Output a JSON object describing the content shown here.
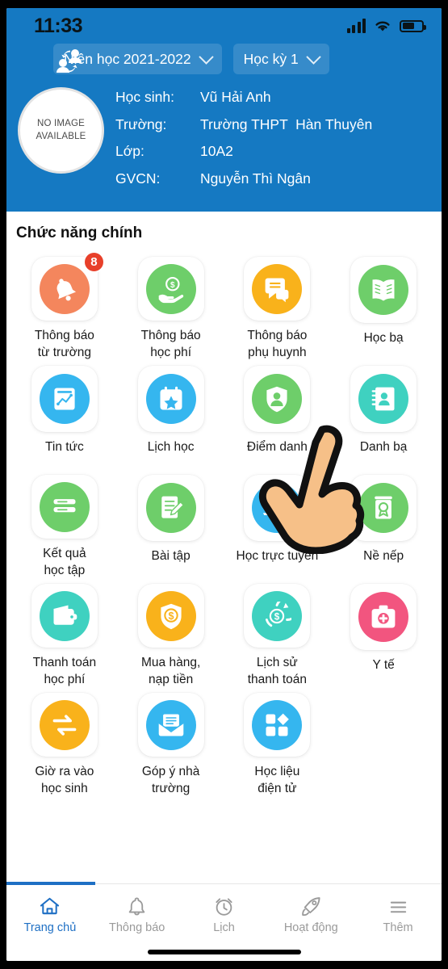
{
  "status_bar": {
    "time": "11:33",
    "signal_icon": "cellular-signal-icon",
    "wifi_icon": "wifi-icon",
    "battery_icon": "battery-icon"
  },
  "header": {
    "bg_color": "#1579c2",
    "switch_student_icon": "switch-students-icon",
    "year_selector": {
      "label": "Niên học 2021-2022",
      "chevron": "chevron-down-icon"
    },
    "term_selector": {
      "label": "Học kỳ 1",
      "chevron": "chevron-down-icon"
    },
    "avatar": {
      "line1": "NO IMAGE",
      "line2": "AVAILABLE"
    },
    "info": [
      {
        "label": "Học sinh:",
        "value": "Vũ Hải Anh"
      },
      {
        "label": "Trường:",
        "value": "Trường THPT  Hàn Thuyên"
      },
      {
        "label": "Lớp:",
        "value": "10A2"
      },
      {
        "label": "GVCN:",
        "value": "Nguyễn Thì Ngân"
      }
    ]
  },
  "main": {
    "section_title": "Chức năng chính",
    "items": [
      {
        "caption": "Thông báo\ntừ trường",
        "icon": "bell-icon",
        "color": "#f4865d",
        "badge": "8"
      },
      {
        "caption": "Thông báo\nhọc phí",
        "icon": "hand-money-icon",
        "color": "#6ece6a",
        "badge": null
      },
      {
        "caption": "Thông báo\nphụ huynh",
        "icon": "chat-bubbles-icon",
        "color": "#f9b21b",
        "badge": null
      },
      {
        "caption": "Học bạ",
        "icon": "open-book-icon",
        "color": "#6ece6a",
        "badge": null
      },
      {
        "caption": "Tin tức",
        "icon": "news-chart-icon",
        "color": "#35b6ef",
        "badge": null
      },
      {
        "caption": "Lịch học",
        "icon": "calendar-star-icon",
        "color": "#35b6ef",
        "badge": null
      },
      {
        "caption": "Điểm danh",
        "icon": "shield-person-icon",
        "color": "#6ece6a",
        "badge": null
      },
      {
        "caption": "Danh bạ",
        "icon": "contacts-book-icon",
        "color": "#3fd1c0",
        "badge": null
      },
      {
        "caption": "Kết quả\nhọc tập",
        "icon": "results-list-icon",
        "color": "#6ece6a",
        "badge": null
      },
      {
        "caption": "Bài tập",
        "icon": "homework-pencil-icon",
        "color": "#6ece6a",
        "badge": null
      },
      {
        "caption": "Học trực tuyến",
        "icon": "online-class-icon",
        "color": "#35b6ef",
        "badge": null
      },
      {
        "caption": "Nề nếp",
        "icon": "conduct-medal-icon",
        "color": "#6ece6a",
        "badge": null
      },
      {
        "caption": "Thanh toán\nhọc phí",
        "icon": "wallet-icon",
        "color": "#3fd1c0",
        "badge": null
      },
      {
        "caption": "Mua hàng,\nnạp tiền",
        "icon": "shield-dollar-icon",
        "color": "#f9b21b",
        "badge": null
      },
      {
        "caption": "Lịch sử\nthanh toán",
        "icon": "payment-history-icon",
        "color": "#3fd1c0",
        "badge": null
      },
      {
        "caption": "Y tế",
        "icon": "medical-kit-icon",
        "color": "#f2557f",
        "badge": null
      },
      {
        "caption": "Giờ ra vào\nhọc sinh",
        "icon": "in-out-arrows-icon",
        "color": "#f9b21b",
        "badge": null
      },
      {
        "caption": "Góp ý nhà\ntrường",
        "icon": "envelope-icon",
        "color": "#35b6ef",
        "badge": null
      },
      {
        "caption": "Học liệu\nđiện tử",
        "icon": "modules-grid-icon",
        "color": "#35b6ef",
        "badge": null
      }
    ]
  },
  "bottom_nav": {
    "active_color": "#1e6fc4",
    "inactive_color": "#9a9a9a",
    "items": [
      {
        "label": "Trang chủ",
        "icon": "home-icon",
        "active": true
      },
      {
        "label": "Thông báo",
        "icon": "bell-outline-icon",
        "active": false
      },
      {
        "label": "Lịch",
        "icon": "alarm-clock-icon",
        "active": false
      },
      {
        "label": "Hoạt động",
        "icon": "rocket-icon",
        "active": false
      },
      {
        "label": "Thêm",
        "icon": "hamburger-menu-icon",
        "active": false
      }
    ]
  },
  "cursor": {
    "icon": "pointing-hand-cursor"
  }
}
